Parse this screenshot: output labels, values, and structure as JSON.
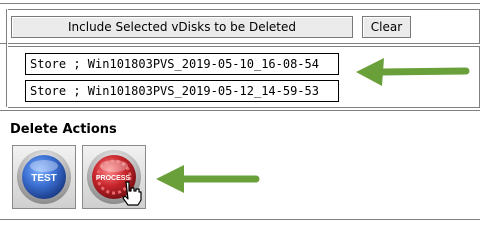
{
  "vdisk_panel": {
    "include_button": "Include Selected vDisks to be Deleted",
    "clear_button": "Clear",
    "selected_vdisks": [
      "Store ; Win101803PVS_2019-05-10_16-08-54",
      "Store ; Win101803PVS_2019-05-12_14-59-53"
    ]
  },
  "delete_actions": {
    "heading": "Delete Actions",
    "test_label": "TEST",
    "process_label": "PROCESS"
  },
  "colors": {
    "arrow_green": "#6aa03a",
    "test_blue": "#3b6fd1",
    "process_red": "#c8262d"
  },
  "icons": [
    "test-icon",
    "process-icon",
    "hand-cursor-icon",
    "arrow-left-icon"
  ]
}
